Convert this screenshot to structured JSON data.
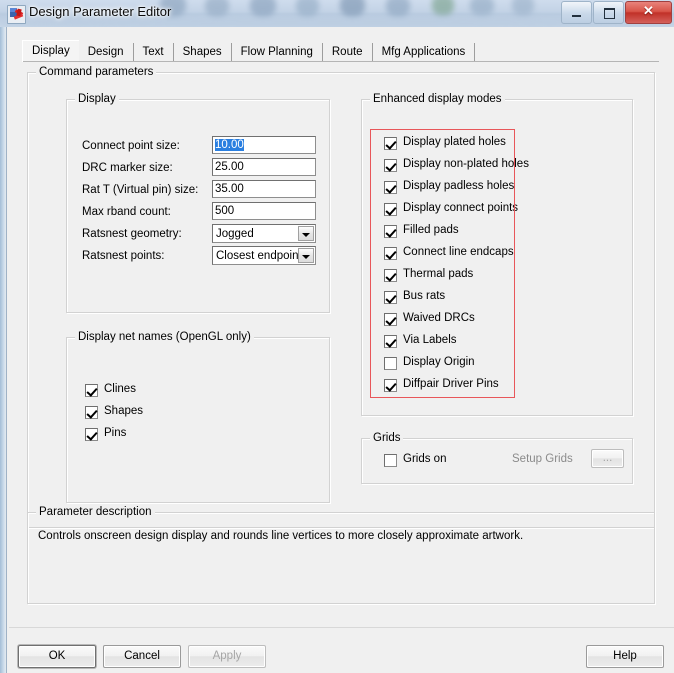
{
  "window": {
    "title": "Design Parameter Editor",
    "icon": "app-icon",
    "minimize_label": "–",
    "maximize_label": "☐",
    "close_label": "✕"
  },
  "tabs": [
    {
      "label": "Display",
      "active": true
    },
    {
      "label": "Design",
      "active": false
    },
    {
      "label": "Text",
      "active": false
    },
    {
      "label": "Shapes",
      "active": false
    },
    {
      "label": "Flow Planning",
      "active": false
    },
    {
      "label": "Route",
      "active": false
    },
    {
      "label": "Mfg Applications",
      "active": false
    }
  ],
  "command_parameters": {
    "legend": "Command parameters",
    "display_group": {
      "legend": "Display",
      "fields": [
        {
          "label": "Connect point size:",
          "value": "10.00",
          "type": "text",
          "selected": true
        },
        {
          "label": "DRC marker size:",
          "value": "25.00",
          "type": "text",
          "selected": false
        },
        {
          "label": "Rat T (Virtual pin) size:",
          "value": "35.00",
          "type": "text",
          "selected": false
        },
        {
          "label": "Max rband count:",
          "value": "500",
          "type": "text",
          "selected": false
        },
        {
          "label": "Ratsnest geometry:",
          "value": "Jogged",
          "type": "combo",
          "selected": false
        },
        {
          "label": "Ratsnest points:",
          "value": "Closest endpoint",
          "type": "combo",
          "selected": false
        }
      ]
    },
    "net_names_group": {
      "legend": "Display net names (OpenGL only)",
      "checkboxes": [
        {
          "label": "Clines",
          "checked": true
        },
        {
          "label": "Shapes",
          "checked": true
        },
        {
          "label": "Pins",
          "checked": true
        }
      ]
    },
    "enhanced_group": {
      "legend": "Enhanced display modes",
      "highlight_color": "#e8565a",
      "checkboxes": [
        {
          "label": "Display plated holes",
          "checked": true
        },
        {
          "label": "Display non-plated holes",
          "checked": true
        },
        {
          "label": "Display padless holes",
          "checked": true
        },
        {
          "label": "Display connect points",
          "checked": true
        },
        {
          "label": "Filled pads",
          "checked": true
        },
        {
          "label": "Connect line endcaps",
          "checked": true
        },
        {
          "label": "Thermal pads",
          "checked": true
        },
        {
          "label": "Bus rats",
          "checked": true
        },
        {
          "label": "Waived DRCs",
          "checked": true
        },
        {
          "label": "Via Labels",
          "checked": true
        },
        {
          "label": "Display Origin",
          "checked": false
        },
        {
          "label": "Diffpair Driver Pins",
          "checked": true
        }
      ]
    },
    "grids_group": {
      "legend": "Grids",
      "grids_on": {
        "label": "Grids on",
        "checked": false
      },
      "setup_grids_label": "Setup Grids",
      "setup_grids_button": "..."
    }
  },
  "parameter_description": {
    "legend": "Parameter description",
    "text": "Controls onscreen design display and rounds line vertices to more closely approximate artwork."
  },
  "footer": {
    "ok": "OK",
    "cancel": "Cancel",
    "apply": "Apply",
    "help": "Help"
  }
}
